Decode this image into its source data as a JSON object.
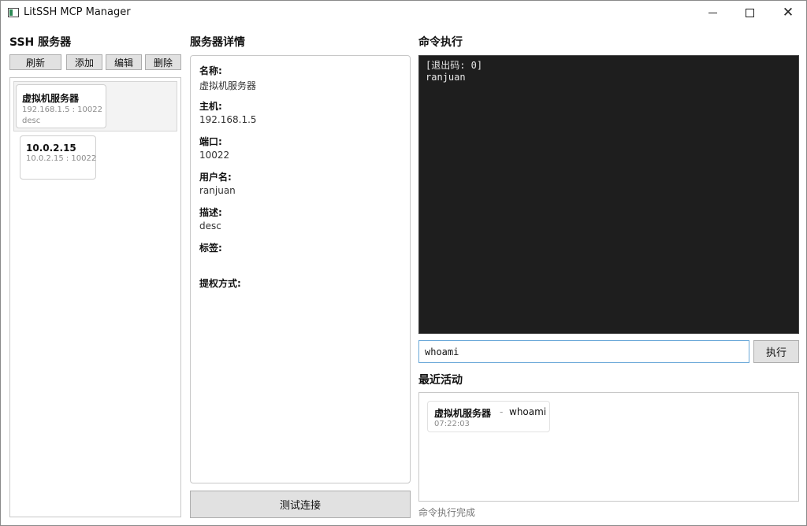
{
  "window": {
    "title": "LitSSH MCP Manager",
    "minimize_icon": "minimize-icon",
    "maximize_icon": "maximize-icon",
    "close_icon": "close-icon",
    "close_glyph": "✕"
  },
  "server_panel": {
    "heading": "SSH 服务器",
    "buttons": {
      "refresh": "刷新",
      "add": "添加",
      "edit": "编辑",
      "delete": "删除"
    },
    "servers": [
      {
        "name": "虚拟机服务器",
        "address": "192.168.1.5 : 10022",
        "description": "desc",
        "selected": true
      },
      {
        "name": "10.0.2.15",
        "address": "10.0.2.15 : 10022",
        "description": "",
        "selected": false
      }
    ]
  },
  "detail_panel": {
    "heading": "服务器详情",
    "fields": {
      "name_label": "名称:",
      "name_value": "虚拟机服务器",
      "host_label": "主机:",
      "host_value": "192.168.1.5",
      "port_label": "端口:",
      "port_value": "10022",
      "user_label": "用户名:",
      "user_value": "ranjuan",
      "desc_label": "描述:",
      "desc_value": "desc",
      "tags_label": "标签:",
      "tags_value": "",
      "priv_label": "提权方式:",
      "priv_value": ""
    },
    "test_button": "测试连接"
  },
  "command_panel": {
    "heading": "命令执行",
    "output_lines": [
      "[退出码: 0]",
      "ranjuan"
    ],
    "input_value": "whoami",
    "exec_button": "执行",
    "activity_heading": "最近活动",
    "activities": [
      {
        "server": "虚拟机服务器",
        "separator": "-",
        "command": "whoami",
        "time": "07:22:03"
      }
    ],
    "status": "命令执行完成"
  },
  "colors": {
    "console_bg": "#1e1e1e",
    "input_focus_border": "#6aa8d8",
    "button_bg": "#e1e1e1"
  }
}
